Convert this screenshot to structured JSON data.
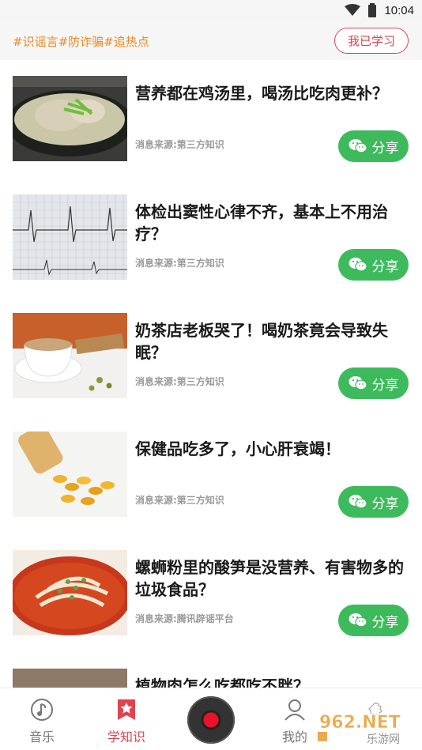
{
  "status": {
    "time": "10:04"
  },
  "topbar": {
    "tags": "#识谣言#防诈骗#追热点",
    "study_label": "我已学习"
  },
  "feed": [
    {
      "title": "营养都在鸡汤里，喝汤比吃肉更补？",
      "source": "消息来源:第三方知识",
      "share": "分享"
    },
    {
      "title": "体检出窦性心律不齐，基本上不用治疗？",
      "source": "消息来源:第三方知识",
      "share": "分享"
    },
    {
      "title": "奶茶店老板哭了！喝奶茶竟会导致失眠？",
      "source": "消息来源:第三方知识",
      "share": "分享"
    },
    {
      "title": "保健品吃多了，小心肝衰竭！",
      "source": "消息来源:第三方知识",
      "share": "分享"
    },
    {
      "title": "螺蛳粉里的酸笋是没营养、有害物多的垃圾食品？",
      "source": "消息来源:腾讯辟谣平台",
      "share": "分享"
    },
    {
      "title": "植物肉怎么吃都吃不胖？",
      "source": "",
      "share": ""
    }
  ],
  "tabbar": {
    "music": "音乐",
    "learn": "学知识",
    "mine": "我的"
  },
  "watermark": {
    "top": "962.NET",
    "bottom": "乐游网"
  },
  "colors": {
    "accent": "#e1434f",
    "share_green": "#3dbb5c",
    "tag_orange": "#e88a2a"
  }
}
